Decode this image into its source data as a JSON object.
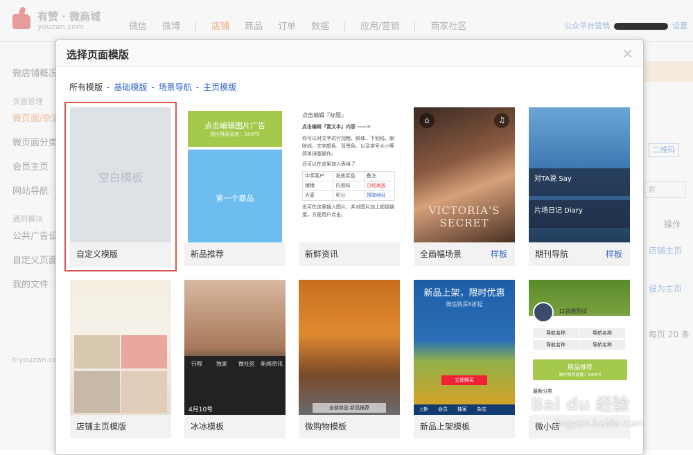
{
  "app": {
    "logo_title": "有赞 · 微商城",
    "logo_sub": "youzan.com"
  },
  "nav": {
    "items": [
      "微信",
      "微博",
      "店铺",
      "商品",
      "订单",
      "数据",
      "应用/营销",
      "商家社区"
    ],
    "active": "店铺",
    "right_link": "公众平台营销",
    "settings": "设置"
  },
  "sidebar": {
    "top": "微店铺概况",
    "group1": "页面管理",
    "items1": [
      "微页面/杂志",
      "微页面分类",
      "会员主页",
      "网站导航"
    ],
    "group2": "通用模块",
    "items2": [
      "公共广告设置",
      "自定义页面模块",
      "我的文件"
    ],
    "footer": "©youzan.com"
  },
  "bg_right": {
    "qr": "二维码",
    "search_placeholder": "索",
    "op": "操作",
    "link1": "店铺主页",
    "link2": "设为主页",
    "paging": "每页 20 条"
  },
  "modal": {
    "title": "选择页面模版",
    "close": "×",
    "filters": [
      "所有模版",
      "基础模版",
      "场景导航",
      "主页模版"
    ],
    "sample_label": "样板",
    "cards": [
      {
        "name": "自定义模版",
        "thumb_text": "空白模板",
        "selected": true
      },
      {
        "name": "新品推荐",
        "top_text": "点击编辑图片广告",
        "top_sub": "图片推荐宽度：580PX",
        "bottom_text": "第一个商品"
      },
      {
        "name": "新鲜资讯"
      },
      {
        "name": "全画幅场景",
        "has_sample": true,
        "thumb_text": "VICTORIA'S SECRET"
      },
      {
        "name": "期刊导航",
        "has_sample": true,
        "band1": "对TA说 Say",
        "band2": "片场日记 Diary"
      },
      {
        "name": "店铺主页模版"
      },
      {
        "name": "冰冰模板",
        "grid": [
          "行程",
          "独家",
          "微社区",
          "新闻资讯"
        ],
        "date": "4月10号"
      },
      {
        "name": "微购物模板",
        "bar": "全部商品  新品推荐"
      },
      {
        "name": "新品上架模板",
        "promo_title": "新品上架，限时优惠",
        "promo_sub": "微信购买8折起",
        "promo_btn": "立即购买",
        "nav": [
          "上新",
          "会员",
          "独家",
          "杂志"
        ]
      },
      {
        "name": "微小店",
        "kdt_name": "口袋通测试",
        "cells": [
          "导航名称",
          "导航名称",
          "导航名称",
          "导航名称"
        ],
        "green": "精品推荐",
        "green_sub": "图片推荐宽度：640PX",
        "cat": "最新分类"
      }
    ],
    "news": {
      "line1": "点击编辑『标题』",
      "line2": "点击编辑『富文本』内容 ——>",
      "para1": "你可以对文字进行加粗、斜体、下划线、删除线、文字颜色、背景色、以及字号大小等简单排版操作。",
      "para2": "还可以在这里加入表格了",
      "table": [
        [
          "中奖客户",
          "发放奖品",
          "备注"
        ],
        [
          "猪猪",
          "内测码",
          "已经发放"
        ],
        [
          "大麦",
          "积分",
          "领取地址"
        ]
      ],
      "para3": "也可在这里插入图片、并对图片加上超级链接，方便用户点击。"
    }
  },
  "watermark": {
    "text": "Bai du 经验",
    "sub": "jingyan.baidu.com"
  }
}
